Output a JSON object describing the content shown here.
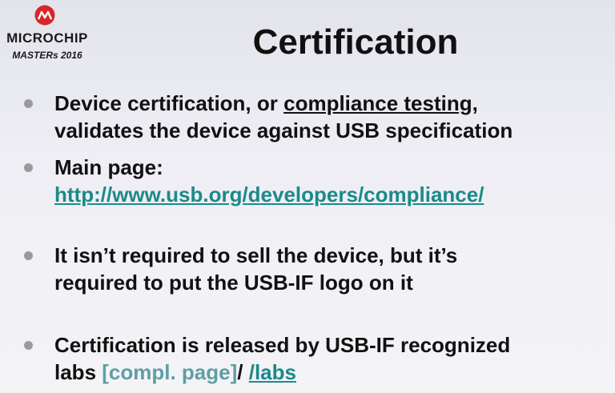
{
  "logo": {
    "company": "MICROCHIP",
    "event": "MASTERs 2016",
    "colors": {
      "mark": "#d6262a",
      "text": "#1a1a1a"
    }
  },
  "title": "Certification",
  "bullets": [
    {
      "line1_before": "Device certification, or ",
      "line1_link": "compliance testing",
      "line1_after": ",",
      "line2": "validates the device against USB specification"
    },
    {
      "line1": "Main page:",
      "line2_link": "http://www.usb.org/developers/compliance/"
    },
    {
      "line1": "It isn’t required to sell the device, but it’s",
      "line2": "required to put the USB-IF logo on it"
    },
    {
      "line1": "Certification is released by USB-IF recognized",
      "line2_before": "labs ",
      "line2_link1": "[compl. page]",
      "line2_sep": "/ ",
      "line2_link2": "/labs"
    }
  ],
  "colors": {
    "link": "#1a8a8a",
    "link_muted": "#5f9ea6",
    "bullet": "#9a9a9a",
    "text": "#111111"
  }
}
